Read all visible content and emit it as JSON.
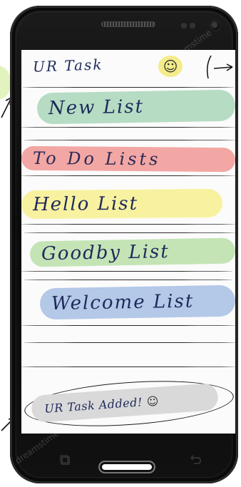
{
  "header": {
    "title": "UR Task",
    "smiley": "☺"
  },
  "lists": [
    {
      "label": "New List",
      "color": "#b6dcc4"
    },
    {
      "label": "To Do Lists",
      "color": "#f2a7a4"
    },
    {
      "label": "Hello List",
      "color": "#f8f2a0"
    },
    {
      "label": "Goodby List",
      "color": "#c4e4b6"
    },
    {
      "label": "Welcome List",
      "color": "#b4c8e8"
    }
  ],
  "toast": {
    "text": "UR Task Added!",
    "smiley": "☺"
  },
  "watermark": {
    "text": "dreamstime"
  },
  "navigation": {
    "recent_icon": "recent-apps-icon",
    "home_icon": "home-button-icon",
    "back_icon": "back-icon"
  }
}
